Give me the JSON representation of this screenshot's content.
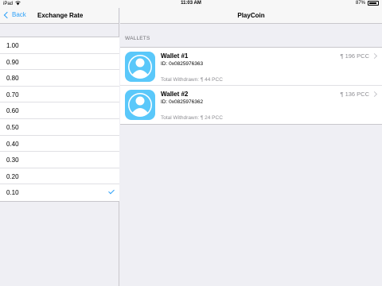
{
  "status_bar": {
    "carrier": "iPad",
    "time": "11:03 AM",
    "battery_text": "87%",
    "battery_level": 0.87
  },
  "master": {
    "back_label": "Back",
    "title": "Exchange Rate",
    "rates": [
      {
        "label": "1.00",
        "selected": false
      },
      {
        "label": "0.90",
        "selected": false
      },
      {
        "label": "0.80",
        "selected": false
      },
      {
        "label": "0.70",
        "selected": false
      },
      {
        "label": "0.60",
        "selected": false
      },
      {
        "label": "0.50",
        "selected": false
      },
      {
        "label": "0.40",
        "selected": false
      },
      {
        "label": "0.30",
        "selected": false
      },
      {
        "label": "0.20",
        "selected": false
      },
      {
        "label": "0.10",
        "selected": true
      }
    ]
  },
  "detail": {
    "title": "PlayCoin",
    "section_header": "WALLETS",
    "wallets": [
      {
        "name": "Wallet #1",
        "id": "ID: 0x0825976363",
        "withdrawn": "Total Withdrawn: ¶ 44 PCC",
        "amount": "¶ 196 PCC"
      },
      {
        "name": "Wallet #2",
        "id": "ID: 0x0825976362",
        "withdrawn": "Total Withdrawn: ¶ 24 PCC",
        "amount": "¶ 136 PCC"
      }
    ]
  },
  "colors": {
    "accent": "#2ea1f8",
    "avatar_bg": "#5ac8fa",
    "secondary_text": "#8e8e93"
  }
}
